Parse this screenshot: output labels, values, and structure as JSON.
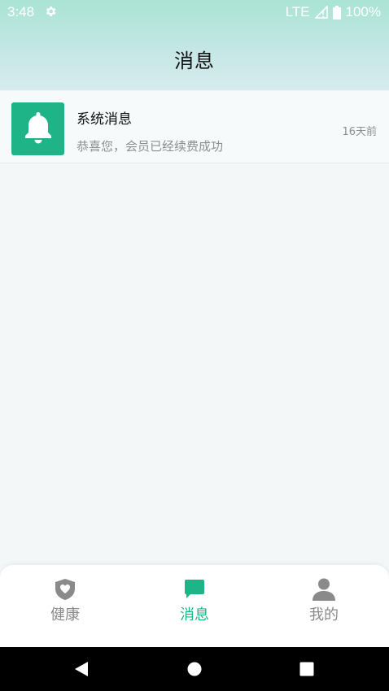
{
  "status_bar": {
    "time": "3:48",
    "network": "LTE",
    "battery": "100%",
    "icons": [
      "gear-icon",
      "signal-icon",
      "battery-icon"
    ]
  },
  "header": {
    "title": "消息"
  },
  "messages": [
    {
      "icon": "bell-icon",
      "title": "系统消息",
      "subtitle": "恭喜您，会员已经续费成功",
      "time": "16天前"
    }
  ],
  "tabs": [
    {
      "label": "健康",
      "icon": "heart-shield-icon",
      "active": false
    },
    {
      "label": "消息",
      "icon": "chat-bubble-icon",
      "active": true
    },
    {
      "label": "我的",
      "icon": "person-icon",
      "active": false
    }
  ],
  "colors": {
    "accent": "#1fb487",
    "inactive": "#8a8a8a",
    "header_top": "#a9e4d3",
    "header_bottom": "#d7ebee"
  }
}
